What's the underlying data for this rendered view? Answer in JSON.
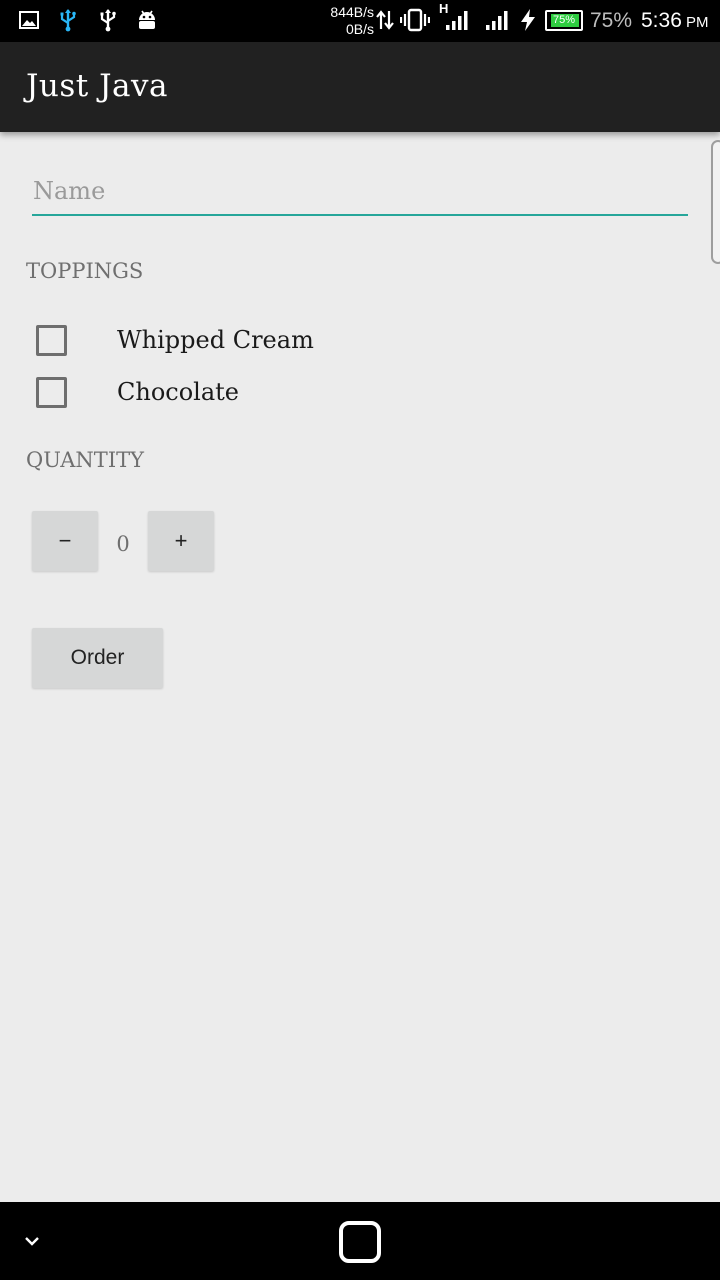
{
  "status_bar": {
    "net_up": "844B/s",
    "net_down": "0B/s",
    "network_type": "H",
    "battery_inner": "75%",
    "battery_percent": "75%",
    "time": "5:36",
    "ampm": "PM",
    "icons": [
      "gallery-icon",
      "usb-icon",
      "usb-icon",
      "android-icon",
      "data-arrows-icon",
      "vibrate-icon",
      "signal-icon",
      "signal-icon",
      "charging-icon",
      "battery-icon"
    ]
  },
  "app_bar": {
    "title": "Just Java"
  },
  "name_field": {
    "placeholder": "Name",
    "value": ""
  },
  "toppings": {
    "label": "TOPPINGS",
    "items": [
      {
        "label": "Whipped Cream",
        "checked": false
      },
      {
        "label": "Chocolate",
        "checked": false
      }
    ]
  },
  "quantity": {
    "label": "QUANTITY",
    "decrement_label": "−",
    "value": "0",
    "increment_label": "+"
  },
  "order_button": {
    "label": "Order"
  },
  "colors": {
    "accent": "#26a69a",
    "app_bar": "#212121",
    "background": "#ececec",
    "button": "#d6d7d7",
    "battery_fill": "#2ecc40"
  }
}
